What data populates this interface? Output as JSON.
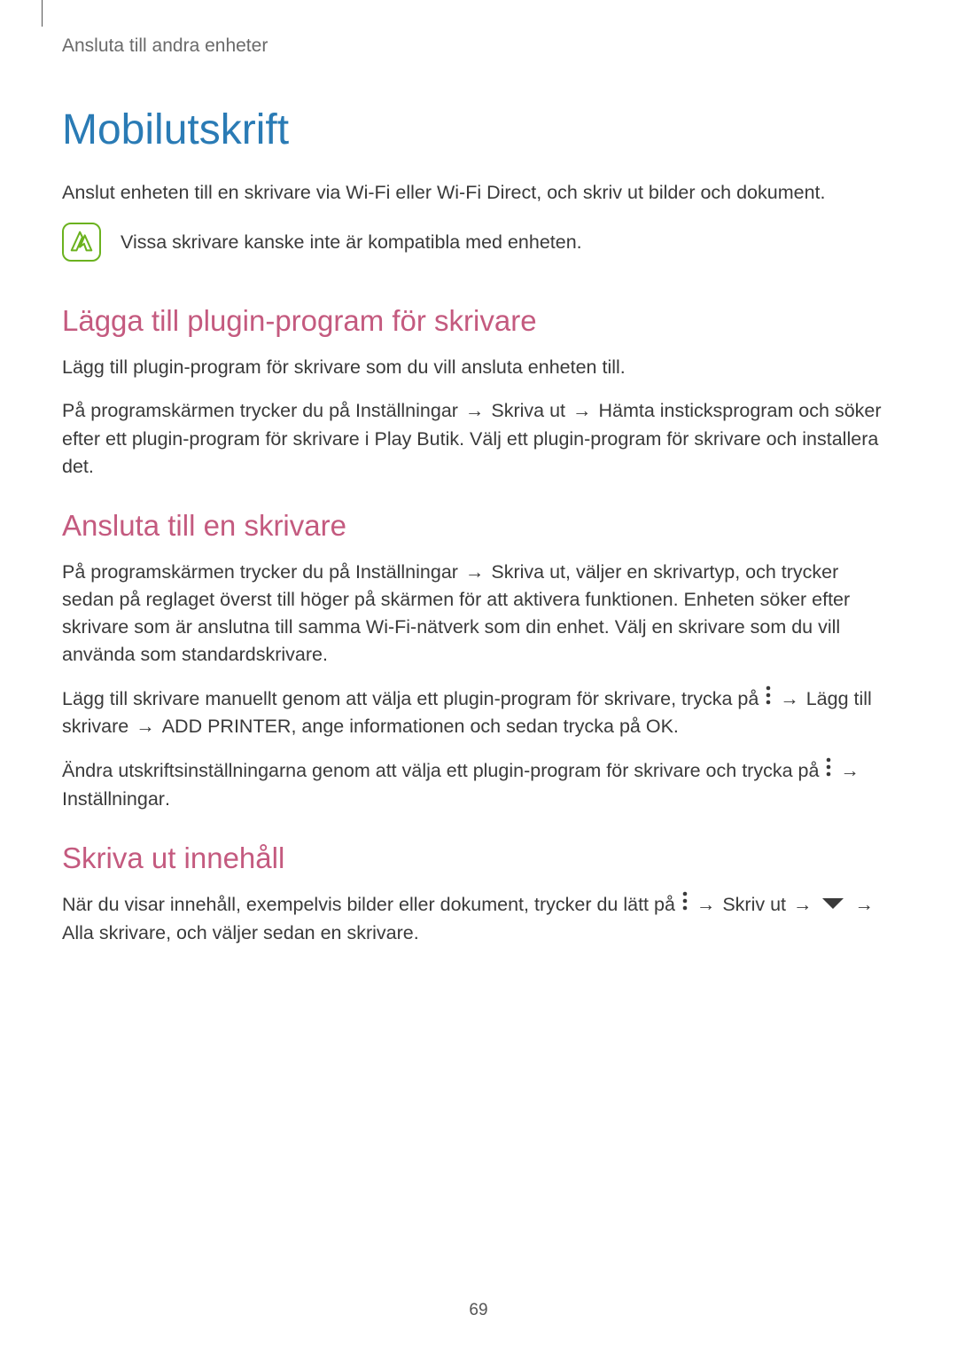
{
  "breadcrumb": "Ansluta till andra enheter",
  "title": "Mobilutskrift",
  "intro": "Anslut enheten till en skrivare via Wi-Fi eller Wi-Fi Direct, och skriv ut bilder och dokument.",
  "note": "Vissa skrivare kanske inte är kompatibla med enheten.",
  "section1": {
    "title": "Lägga till plugin-program för skrivare",
    "p1": "Lägg till plugin-program för skrivare som du vill ansluta enheten till.",
    "p2_pre": "På programskärmen trycker du på ",
    "p2_b1": "Inställningar",
    "p2_arr1": " → ",
    "p2_b2": "Skriva ut",
    "p2_arr2": " → ",
    "p2_b3": "Hämta insticksprogram",
    "p2_mid": " och söker efter ett plugin-program för skrivare i ",
    "p2_b4": "Play Butik",
    "p2_end": ". Välj ett plugin-program för skrivare och installera det."
  },
  "section2": {
    "title": "Ansluta till en skrivare",
    "p1_pre": "På programskärmen trycker du på ",
    "p1_b1": "Inställningar",
    "p1_arr1": " → ",
    "p1_b2": "Skriva ut",
    "p1_end": ", väljer en skrivartyp, och trycker sedan på reglaget överst till höger på skärmen för att aktivera funktionen. Enheten söker efter skrivare som är anslutna till samma Wi-Fi-nätverk som din enhet. Välj en skrivare som du vill använda som standardskrivare.",
    "p2_pre": "Lägg till skrivare manuellt genom att välja ett plugin-program för skrivare, trycka på ",
    "p2_arr1": " → ",
    "p2_b1": "Lägg till skrivare",
    "p2_arr2": " → ",
    "p2_b2": "ADD PRINTER",
    "p2_mid": ", ange informationen och sedan trycka på ",
    "p2_b3": "OK",
    "p2_end": ".",
    "p3_pre": "Ändra utskriftsinställningarna genom att välja ett plugin-program för skrivare och trycka på ",
    "p3_arr1": " → ",
    "p3_b1": "Inställningar",
    "p3_end": "."
  },
  "section3": {
    "title": "Skriva ut innehåll",
    "p1_pre": "När du visar innehåll, exempelvis bilder eller dokument, trycker du lätt på ",
    "p1_arr1": " → ",
    "p1_b1": "Skriv ut",
    "p1_arr2": " → ",
    "p1_arr3": " → ",
    "p1_b2": "Alla skrivare",
    "p1_end": ", och väljer sedan en skrivare."
  },
  "pageNumber": "69"
}
